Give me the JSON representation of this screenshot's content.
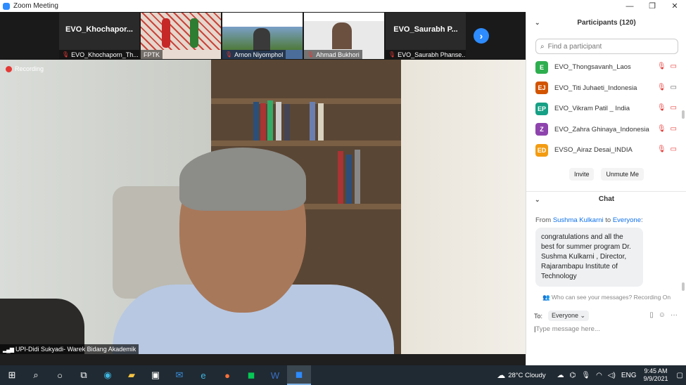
{
  "window": {
    "title": "Zoom Meeting",
    "controls": [
      "—",
      "❐",
      "✕"
    ]
  },
  "thumbnails": [
    {
      "big_label": "EVO_Khochapor...",
      "name": "EVO_Khochaporn_Th...",
      "muted": true,
      "bg": "#111111"
    },
    {
      "big_label": "",
      "name": "FPTK",
      "muted": false,
      "bg": "#e8dcd2"
    },
    {
      "big_label": "",
      "name": "Arnon Niyomphol",
      "muted": true,
      "bg": "#4a6d9a"
    },
    {
      "big_label": "",
      "name": "Ahmad Bukhori",
      "muted": true,
      "bg": "#e9e9e9"
    },
    {
      "big_label": "EVO_Saurabh P...",
      "name": "EVO_Saurabh Phanse...",
      "muted": true,
      "bg": "#111111"
    }
  ],
  "main": {
    "recording_label": "Recording",
    "speaker": "UPI-Didi Sukyadi- Warek Bidang Akademik"
  },
  "participants": {
    "title": "Participants (120)",
    "search_placeholder": "Find a participant",
    "list": [
      {
        "initials": "E",
        "color": "#2eae4f",
        "name": "EVO_Thongsavanh_Laos",
        "video_off": true
      },
      {
        "initials": "EJ",
        "color": "#d35400",
        "name": "EVO_Titi Juhaeti_Indonesia",
        "video_off": false
      },
      {
        "initials": "EP",
        "color": "#16a085",
        "name": "EVO_Vikram Patil _ India",
        "video_off": true
      },
      {
        "initials": "Z",
        "color": "#8e44ad",
        "name": "EVO_Zahra Ghinaya_Indonesia",
        "video_off": true
      },
      {
        "initials": "ED",
        "color": "#f39c12",
        "name": "EVSO_Airaz Desai_INDIA",
        "video_off": true
      }
    ],
    "invite_label": "Invite",
    "unmute_label": "Unmute Me"
  },
  "chat": {
    "title": "Chat",
    "from_prefix": "From",
    "sender": "Sushma Kulkarni",
    "to_word": "to",
    "recipient": "Everyone",
    "message": "congratulations and all the best for summer program Dr. Sushma Kulkarni , Director, Rajarambapu Institute of Technology",
    "who_can_see": "Who can see your messages? Recording On",
    "to_label": "To:",
    "to_value": "Everyone",
    "input_placeholder": "Type message here..."
  },
  "taskbar": {
    "weather": "28°C  Cloudy",
    "lang": "ENG",
    "time": "9:45 AM",
    "date": "9/9/2021"
  }
}
